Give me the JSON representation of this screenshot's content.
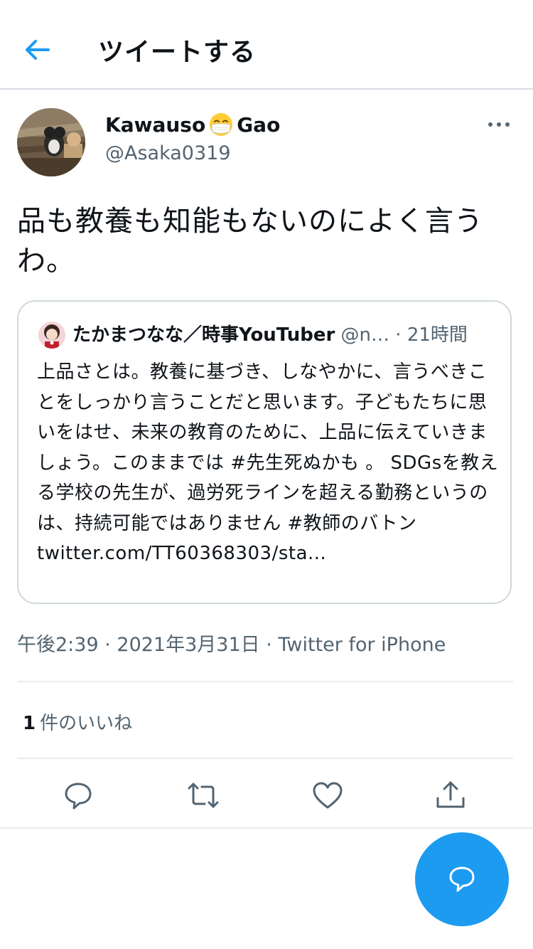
{
  "header": {
    "title": "ツイートする",
    "back_icon": "arrow-left-icon",
    "accent_color": "#1d9bf0"
  },
  "tweet": {
    "display_name_part1": "Kawauso",
    "display_name_emoji": "face-with-medical-mask-emoji",
    "display_name_part2": "Gao",
    "handle": "@Asaka0319",
    "text": "品も教養も知能もないのによく言うわ。",
    "more_icon": "more-horizontal-icon"
  },
  "quoted": {
    "name": "たかまつなな／時事YouTuber",
    "handle": "@n…",
    "separator": " · ",
    "time": "21時間",
    "body": "上品さとは。教養に基づき、しなやかに、言うべきことをしっかり言うことだと思います。子どもたちに思いをはせ、未来の教育のために、上品に伝えていきましょう。このままでは #先生死ぬかも 。 SDGsを教える学校の先生が、過労死ラインを超える勤務というのは、持続可能ではありません #教師のバトン",
    "link": "twitter.com/TT60368303/sta..."
  },
  "meta": {
    "time": "午後2:39",
    "sep1": " · ",
    "date": "2021年3月31日",
    "sep2": " · ",
    "client": "Twitter for iPhone"
  },
  "stats": {
    "likes_count": "1",
    "likes_label": "件のいいね"
  },
  "actions": [
    {
      "icon": "reply-icon"
    },
    {
      "icon": "retweet-icon"
    },
    {
      "icon": "like-heart-icon"
    },
    {
      "icon": "share-icon"
    }
  ],
  "fab": {
    "icon": "compose-reply-icon",
    "color": "#1d9bf0"
  }
}
